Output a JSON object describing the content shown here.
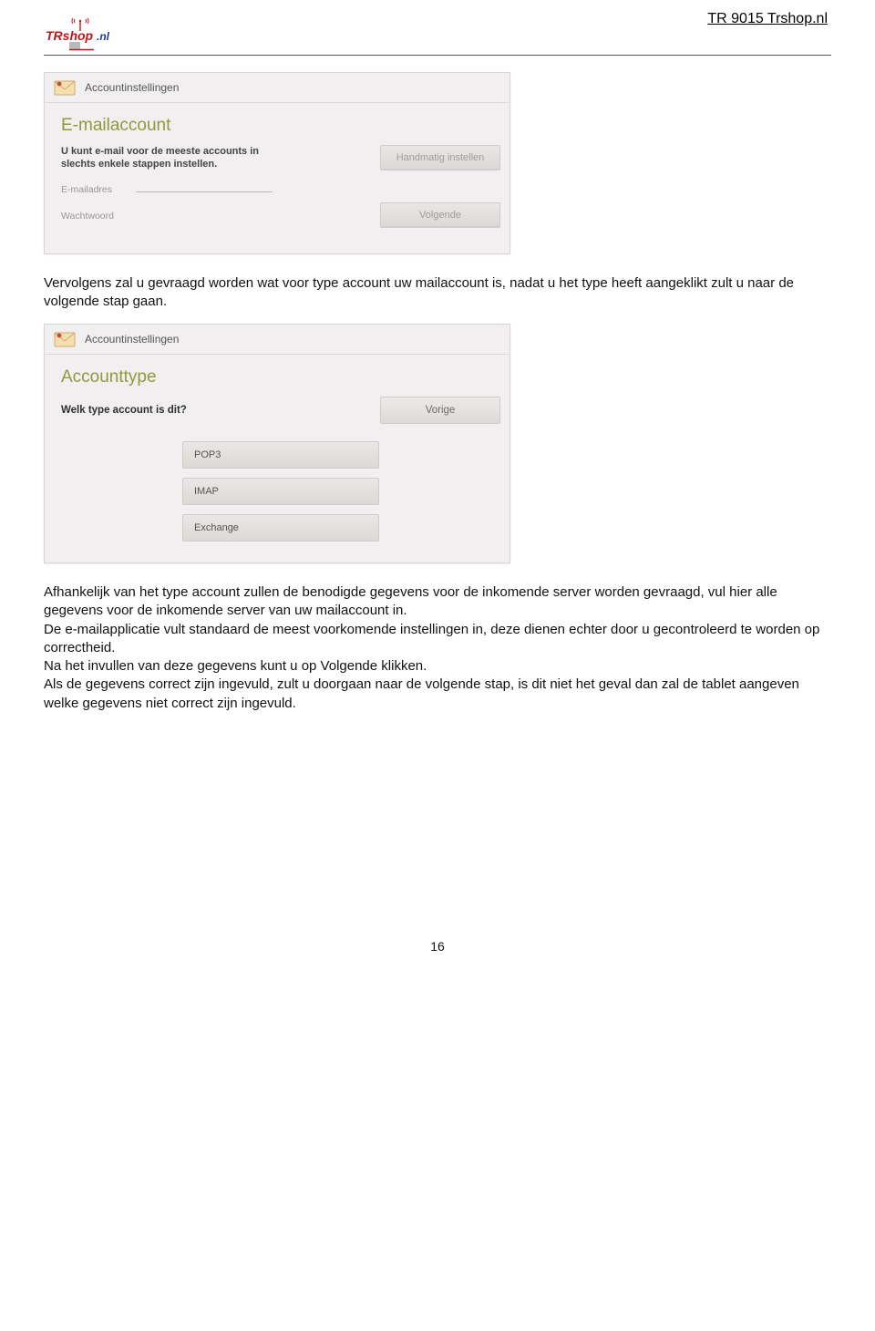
{
  "header": {
    "title": "TR 9015  Trshop.nl",
    "logo_text_1": "TRshop",
    "logo_text_2": ".nl"
  },
  "para1": "Vervolgens zal u gevraagd worden wat voor type account uw mailaccount is, nadat u het type heeft aangeklikt zult u naar de volgende stap gaan.",
  "shot1": {
    "header": "Accountinstellingen",
    "title": "E-mailaccount",
    "sub": "U kunt e-mail voor de meeste accounts in slechts enkele stappen instellen.",
    "label_email": "E-mailadres",
    "label_pass": "Wachtwoord",
    "btn_manual": "Handmatig instellen",
    "btn_next": "Volgende"
  },
  "shot2": {
    "header": "Accountinstellingen",
    "title": "Accounttype",
    "question": "Welk type account is dit?",
    "btn_prev": "Vorige",
    "type1": "POP3",
    "type2": "IMAP",
    "type3": "Exchange"
  },
  "para2a": "Afhankelijk van het type account zullen de benodigde gegevens voor de inkomende server worden gevraagd, vul hier alle gegevens voor de inkomende server van uw mailaccount in.",
  "para2b": "De e-mailapplicatie vult standaard de meest voorkomende instellingen in, deze dienen echter door u gecontroleerd te worden op correctheid.",
  "para2c": "Na het invullen van deze gegevens kunt u op Volgende klikken.",
  "para2d": "Als de gegevens correct zijn ingevuld, zult u doorgaan naar de volgende stap, is dit niet het geval dan zal de tablet aangeven welke gegevens niet correct zijn ingevuld.",
  "page_number": "16"
}
